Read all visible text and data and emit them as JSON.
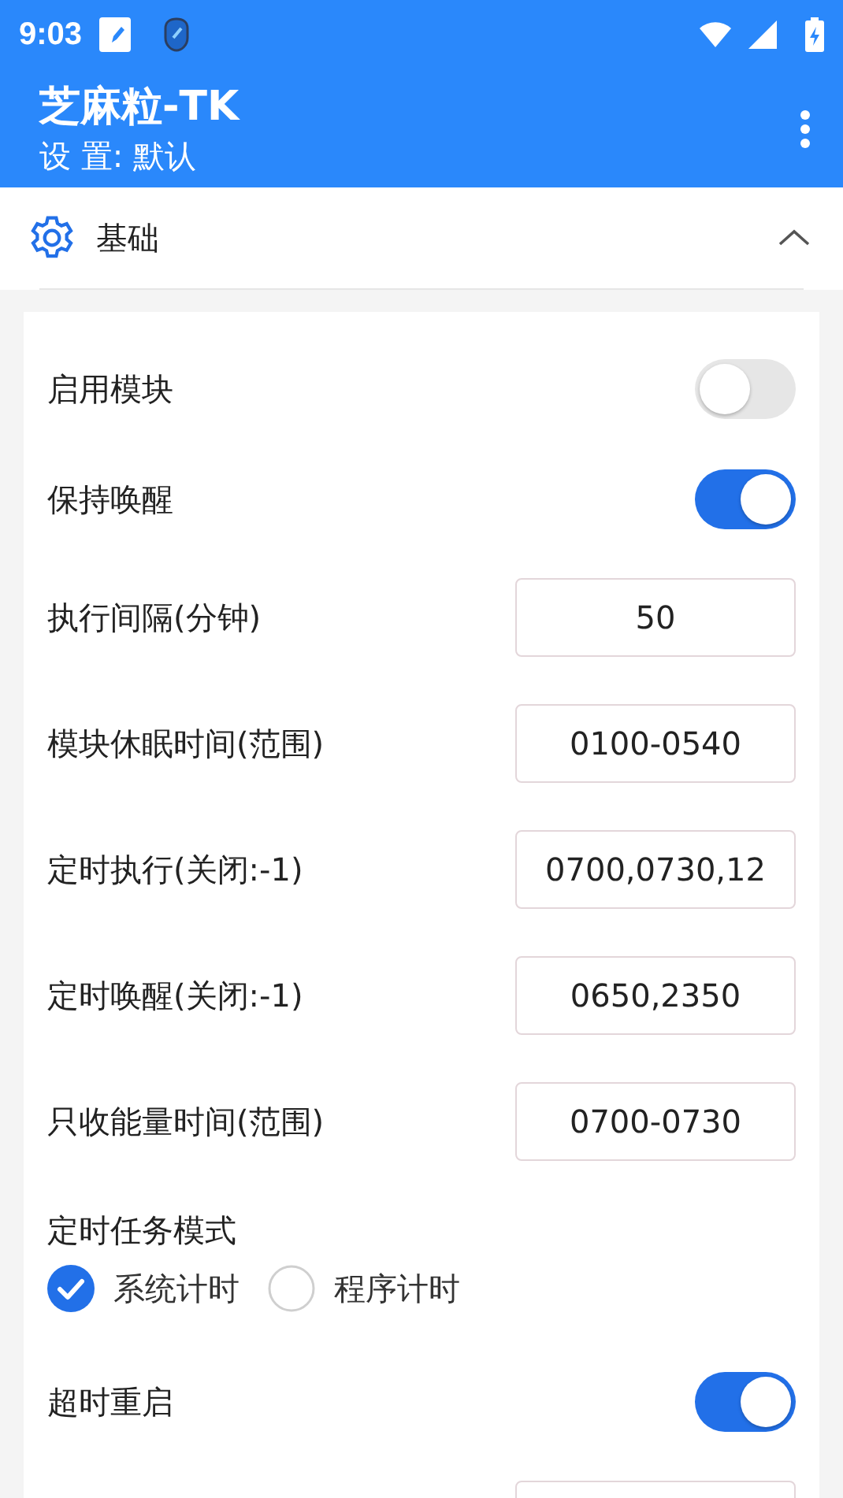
{
  "status_bar": {
    "time": "9:03"
  },
  "app_bar": {
    "title": "芝麻粒-TK",
    "subtitle": "设 置: 默认"
  },
  "section": {
    "title": "基础",
    "expanded": true
  },
  "rows": [
    {
      "kind": "toggle",
      "label": "启用模块",
      "on": false
    },
    {
      "kind": "toggle",
      "label": "保持唤醒",
      "on": true
    },
    {
      "kind": "input",
      "label": "执行间隔(分钟)",
      "value": "50"
    },
    {
      "kind": "input",
      "label": "模块休眠时间(范围)",
      "value": "0100-0540"
    },
    {
      "kind": "input",
      "label": "定时执行(关闭:-1)",
      "value": "0700,0730,12"
    },
    {
      "kind": "input",
      "label": "定时唤醒(关闭:-1)",
      "value": "0650,2350"
    },
    {
      "kind": "input",
      "label": "只收能量时间(范围)",
      "value": "0700-0730"
    },
    {
      "kind": "radio",
      "label": "定时任务模式",
      "options": [
        {
          "label": "系统计时",
          "selected": true
        },
        {
          "label": "程序计时",
          "selected": false
        }
      ]
    },
    {
      "kind": "toggle",
      "label": "超时重启",
      "on": true
    },
    {
      "kind": "input"
    }
  ]
}
